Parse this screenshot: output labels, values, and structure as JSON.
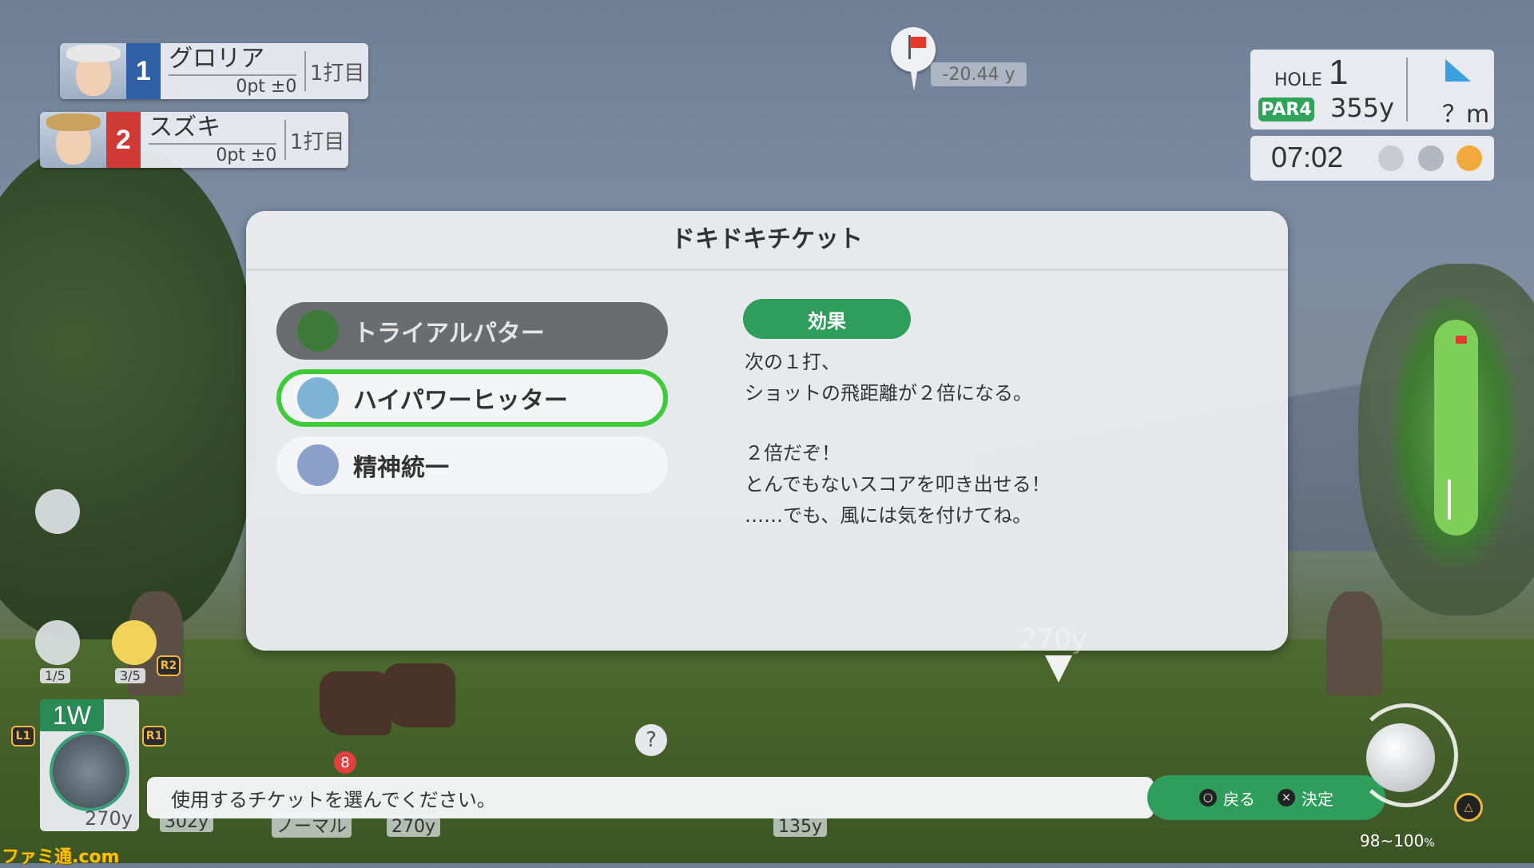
{
  "players": [
    {
      "rank": "1",
      "name": "グロリア",
      "points": "0pt ±0",
      "stroke": "1打目",
      "rank_color": "#2f5fa4"
    },
    {
      "rank": "2",
      "name": "スズキ",
      "points": "0pt ±0",
      "stroke": "1打目",
      "rank_color": "#cf3a37"
    }
  ],
  "pin": {
    "distance": "-20.44 y"
  },
  "hole": {
    "label": "HOLE",
    "number": "1",
    "par": "PAR4",
    "yards": "355y",
    "wind": "？m",
    "time": "07:02"
  },
  "dialog": {
    "title": "ドキドキチケット",
    "tickets": [
      {
        "label": "トライアルパター",
        "icon": "putter-icon"
      },
      {
        "label": "ハイパワーヒッター",
        "icon": "power-hitter-icon"
      },
      {
        "label": "精神統一",
        "icon": "meditation-icon"
      }
    ],
    "effect_label": "効果",
    "effect_lines": [
      "次の１打、",
      "ショットの飛距離が２倍になる。",
      "２倍だぞ！",
      "とんでもないスコアを叩き出せる！",
      "……でも、風には気を付けてね。"
    ]
  },
  "hud": {
    "camera_count": "1/5",
    "item_count": "3/5",
    "club": "1W",
    "club_distance": "270y",
    "aim_distance": "270y",
    "btn_l1": "L1",
    "btn_r1": "R1",
    "btn_r2": "R2",
    "badge_count": "8",
    "dist_labels": [
      "302y",
      "ノーマル",
      "270y",
      "135y"
    ],
    "power_range": "98~100",
    "power_unit": "%"
  },
  "bottom": {
    "message": "使用するチケットを選んでください。",
    "back_label": "戻る",
    "confirm_label": "決定",
    "back_symbol": "○",
    "confirm_symbol": "×"
  },
  "watermark": "ファミ通.com",
  "colors": {
    "accent_green": "#2f9d5b",
    "selected_outline": "#3fca3a"
  }
}
